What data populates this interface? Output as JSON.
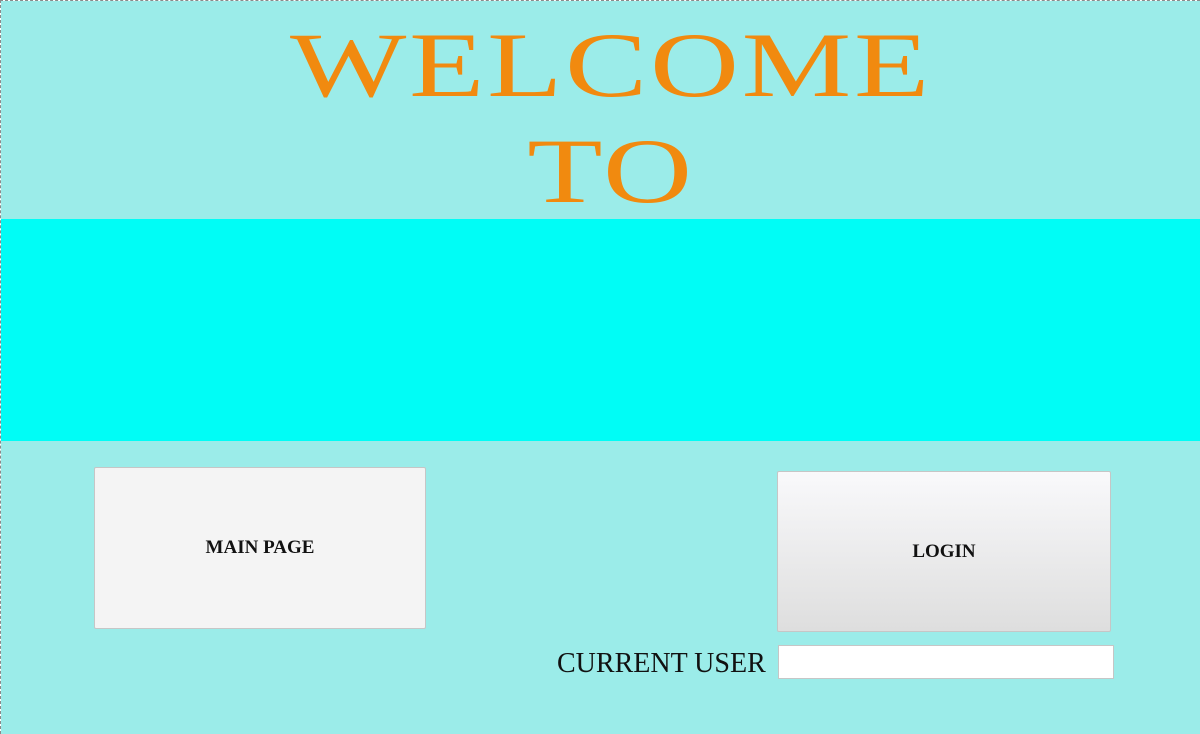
{
  "header": {
    "title_line_1": "WELCOME",
    "title_line_2": "TO"
  },
  "buttons": {
    "main_page": "MAIN PAGE",
    "login": "LOGIN"
  },
  "current_user": {
    "label": "CURRENT USER",
    "value": ""
  },
  "colors": {
    "background": "#9bece9",
    "banner": "#00fdf6",
    "title_text": "#f18a0f"
  }
}
